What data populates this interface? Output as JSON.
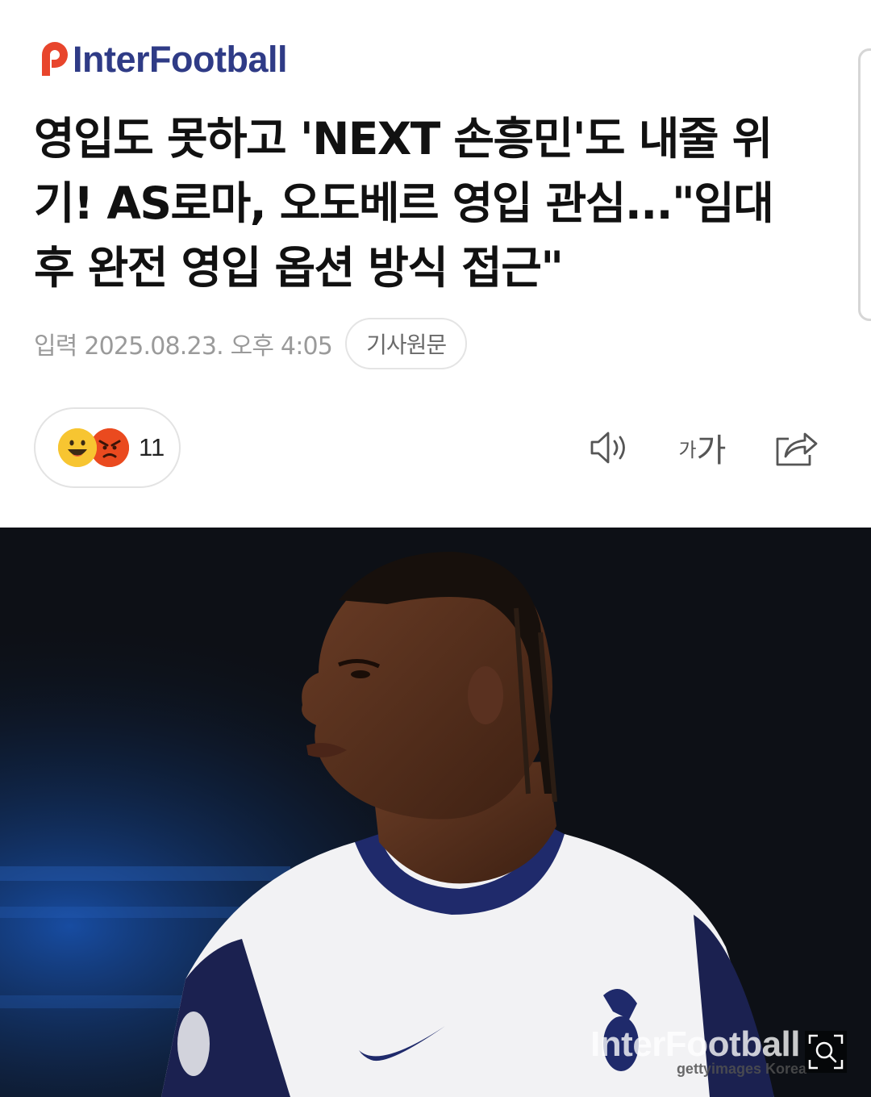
{
  "header": {
    "logo_text": "InterFootball",
    "brand_color": "#2f3b86",
    "logo_mark_color": "#e8452c"
  },
  "article": {
    "title": "영입도 못하고 'NEXT 손흥민'도 내줄 위기! AS로마, 오도베르 영입 관심...\"임대 후 완전 영입 옵션 방식 접근\"",
    "date_label": "입력 2025.08.23. 오후 4:05",
    "original_link_label": "기사원문"
  },
  "reactions": {
    "count": "11",
    "icons": [
      "smile-emoji-icon",
      "angry-emoji-icon"
    ]
  },
  "toolbar": {
    "font_small": "가",
    "font_big": "가",
    "icons": [
      "speaker-icon",
      "font-size-icon",
      "share-icon"
    ]
  },
  "image": {
    "watermark": "InterFootball",
    "credit": "gettyimages Korea",
    "zoom_icon": "zoom-magnifier-icon"
  }
}
